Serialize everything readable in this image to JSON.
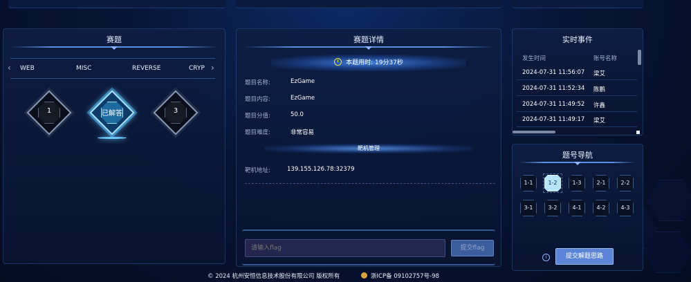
{
  "left_panel": {
    "title": "赛题",
    "categories": [
      "WEB",
      "MISC",
      "REVERSE",
      "CRYP"
    ],
    "challenges": [
      {
        "label": "1",
        "solved": false
      },
      {
        "label": "已解答",
        "solved": true
      },
      {
        "label": "3",
        "solved": false
      }
    ]
  },
  "center_panel": {
    "title": "赛题详情",
    "timer_text": "本题用时: 19分37秒",
    "fields": {
      "name_label": "题目名称:",
      "name_value": "EzGame",
      "content_label": "题目内容:",
      "content_value": "EzGame",
      "score_label": "题目分值:",
      "score_value": "50.0",
      "difficulty_label": "题目难度:",
      "difficulty_value": "非常容易"
    },
    "section_title": "靶机管理",
    "target_label": "靶机地址:",
    "target_value": "139.155.126.78:32379",
    "flag_placeholder": "请输入flag",
    "flag_submit": "提交flag"
  },
  "events_panel": {
    "title": "实时事件",
    "col_time": "发生时间",
    "col_account": "账号名称",
    "rows": [
      {
        "time": "2024-07-31 11:56:07",
        "name": "梁艾"
      },
      {
        "time": "2024-07-31 11:52:34",
        "name": "陈鹏"
      },
      {
        "time": "2024-07-31 11:49:52",
        "name": "许鑫"
      },
      {
        "time": "2024-07-31 11:49:17",
        "name": "梁艾"
      }
    ]
  },
  "nav_panel": {
    "title": "题号导航",
    "row1": [
      "1-1",
      "1-2",
      "1-3",
      "2-1",
      "2-2"
    ],
    "row2": [
      "3-1",
      "3-2",
      "4-1",
      "4-2",
      "4-3"
    ],
    "active": "1-2",
    "info_icon": "i",
    "submit_label": "提交解题思路"
  },
  "footer": {
    "copyright": "© 2024 杭州安恒信息技术股份有限公司 版权所有",
    "icp": "浙ICP备 09102757号-98"
  },
  "colors": {
    "accent": "#5b84d6",
    "solved_glow": "#6ecbff",
    "timer_icon": "#e8e43a"
  }
}
